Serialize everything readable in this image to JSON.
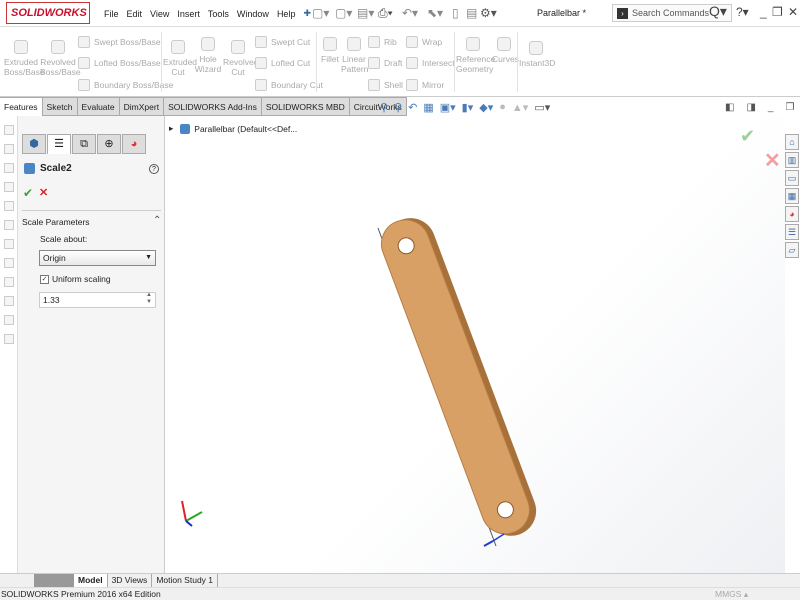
{
  "app": {
    "logo": "SOLIDWORKS",
    "title": "Parallelbar *",
    "search_placeholder": "Search Commands"
  },
  "menu": [
    "File",
    "Edit",
    "View",
    "Insert",
    "Tools",
    "Window",
    "Help"
  ],
  "ribbon": {
    "large": [
      "Extruded Boss/Base",
      "Revolved Boss/Base",
      "Extruded Cut",
      "Hole Wizard",
      "Revolved Cut",
      "Fillet",
      "Linear Pattern",
      "Reference Geometry",
      "Curves",
      "Instant3D"
    ],
    "small": [
      "Swept Boss/Base",
      "Lofted Boss/Base",
      "Boundary Boss/Base",
      "Swept Cut",
      "Lofted Cut",
      "Boundary Cut",
      "Rib",
      "Draft",
      "Shell",
      "Wrap",
      "Intersect",
      "Mirror"
    ]
  },
  "tabs": [
    "Features",
    "Sketch",
    "Evaluate",
    "DimXpert",
    "SOLIDWORKS Add-Ins",
    "SOLIDWORKS MBD",
    "CircuitWorks"
  ],
  "panel": {
    "feature": "Scale2",
    "section": "Scale Parameters",
    "scale_about_label": "Scale about:",
    "scale_about_value": "Origin",
    "uniform_label": "Uniform scaling",
    "uniform_checked": true,
    "scale_value": "1.33"
  },
  "tree": {
    "root": "Parallelbar  (Default<<Def..."
  },
  "bottom_tabs": [
    "Model",
    "3D Views",
    "Motion Study 1"
  ],
  "status": {
    "text": "SOLIDWORKS Premium 2016 x64 Edition",
    "units": "MMGS"
  },
  "colors": {
    "part": "#d9a066",
    "part_edge": "#a8713a",
    "brand": "#c8102e"
  }
}
